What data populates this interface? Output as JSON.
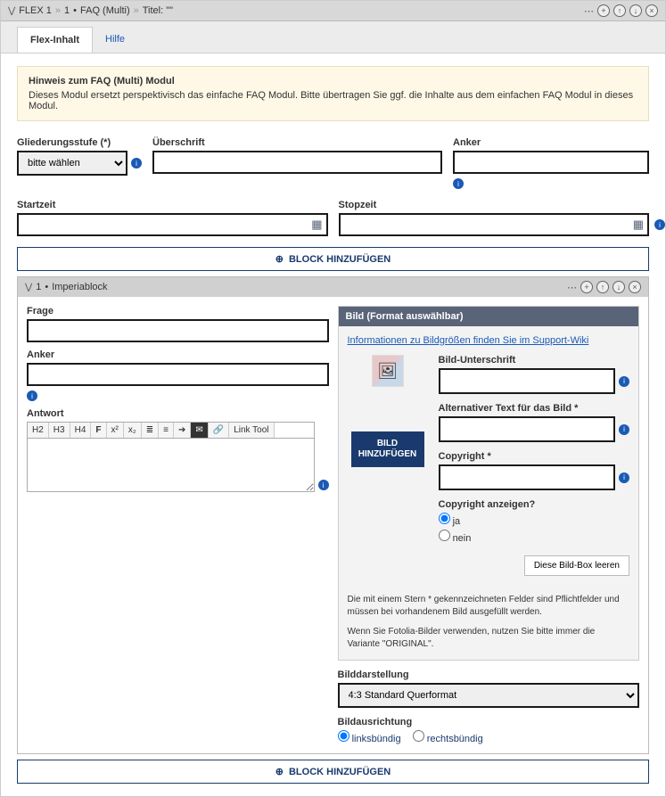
{
  "header": {
    "flex": "FLEX 1",
    "arrow1": "»",
    "idx": "1",
    "bullet": "•",
    "module": "FAQ (Multi)",
    "arrow2": "»",
    "titleLabel": "Titel: \"\""
  },
  "tabs": {
    "active": "Flex-Inhalt",
    "help": "Hilfe"
  },
  "notice": {
    "title": "Hinweis zum FAQ (Multi) Modul",
    "text": "Dieses Modul ersetzt perspektivisch das einfache FAQ Modul. Bitte übertragen Sie ggf. die Inhalte aus dem einfachen FAQ Modul in dieses Modul."
  },
  "fields": {
    "gliederung": {
      "label": "Gliederungsstufe (*)",
      "placeholder": "bitte wählen"
    },
    "ueberschrift": {
      "label": "Überschrift"
    },
    "anker": {
      "label": "Anker"
    },
    "startzeit": {
      "label": "Startzeit"
    },
    "stopzeit": {
      "label": "Stopzeit"
    }
  },
  "blockBtn": "BLOCK HINZUFÜGEN",
  "subHeader": {
    "idx": "1",
    "bullet": "•",
    "name": "Imperiablock"
  },
  "qa": {
    "frage": "Frage",
    "anker": "Anker",
    "antwort": "Antwort",
    "tb": {
      "h2": "H2",
      "h3": "H3",
      "h4": "H4",
      "bold": "F",
      "sup": "x²",
      "sub": "x₂",
      "ul": "",
      "ol": "",
      "indent": "",
      "mail": "✉",
      "link": "🔗",
      "linktool": "Link Tool"
    }
  },
  "bild": {
    "header": "Bild (Format auswählbar)",
    "link": "Informationen zu Bildgrößen finden Sie im Support-Wiki",
    "addBtn": "BILD HINZUFÜGEN",
    "unterschrift": "Bild-Unterschrift",
    "alt": "Alternativer Text für das Bild *",
    "copyright": "Copyright *",
    "showCopy": "Copyright anzeigen?",
    "ja": "ja",
    "nein": "nein",
    "clear": "Diese Bild-Box leeren",
    "note1": "Die mit einem Stern * gekennzeichneten Felder sind Pflichtfelder und müssen bei vorhandenem Bild ausgefüllt werden.",
    "note2": "Wenn Sie Fotolia-Bilder verwenden, nutzen Sie bitte immer die Variante \"ORIGINAL\".",
    "darstellung": {
      "label": "Bilddarstellung",
      "value": "4:3 Standard Querformat"
    },
    "ausrichtung": {
      "label": "Bildausrichtung",
      "links": "linksbündig",
      "rechts": "rechtsbündig"
    }
  }
}
